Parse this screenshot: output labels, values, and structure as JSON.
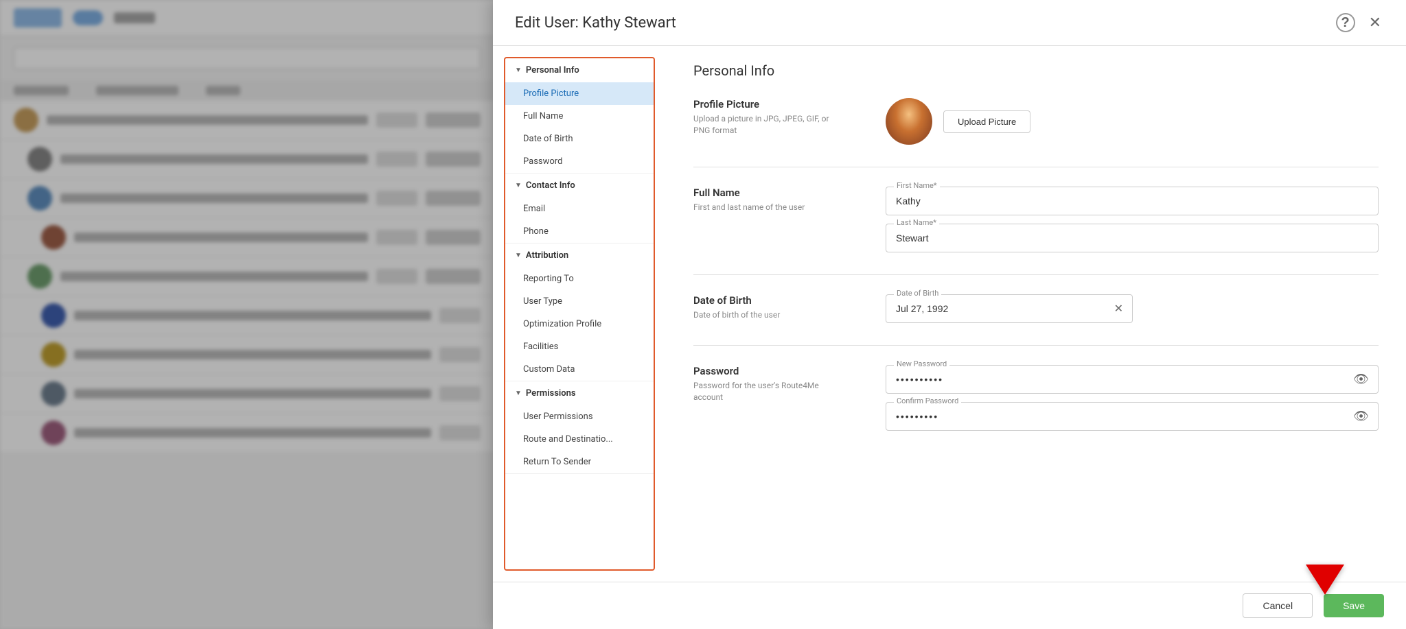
{
  "modal": {
    "title": "Edit User: Kathy Stewart",
    "section_title": "Personal Info"
  },
  "nav": {
    "groups": [
      {
        "label": "Personal Info",
        "expanded": true,
        "items": [
          {
            "label": "Profile Picture",
            "active": true
          },
          {
            "label": "Full Name",
            "active": false
          },
          {
            "label": "Date of Birth",
            "active": false
          },
          {
            "label": "Password",
            "active": false
          }
        ]
      },
      {
        "label": "Contact Info",
        "expanded": true,
        "items": [
          {
            "label": "Email",
            "active": false
          },
          {
            "label": "Phone",
            "active": false
          }
        ]
      },
      {
        "label": "Attribution",
        "expanded": true,
        "items": [
          {
            "label": "Reporting To",
            "active": false
          },
          {
            "label": "User Type",
            "active": false
          },
          {
            "label": "Optimization Profile",
            "active": false
          },
          {
            "label": "Facilities",
            "active": false
          },
          {
            "label": "Custom Data",
            "active": false
          }
        ]
      },
      {
        "label": "Permissions",
        "expanded": true,
        "items": [
          {
            "label": "User Permissions",
            "active": false
          },
          {
            "label": "Route and Destinatio...",
            "active": false
          },
          {
            "label": "Return To Sender",
            "active": false
          }
        ]
      }
    ]
  },
  "fields": {
    "profile_picture": {
      "title": "Profile Picture",
      "desc": "Upload a picture in JPG, JPEG, GIF, or PNG format",
      "upload_label": "Upload Picture"
    },
    "full_name": {
      "title": "Full Name",
      "desc": "First and last name of the user",
      "first_name_label": "First Name*",
      "first_name_value": "Kathy",
      "last_name_label": "Last Name*",
      "last_name_value": "Stewart"
    },
    "dob": {
      "title": "Date of Birth",
      "desc": "Date of birth of the user",
      "label": "Date of Birth",
      "value": "Jul 27, 1992"
    },
    "password": {
      "title": "Password",
      "desc": "Password for the user's Route4Me account",
      "new_password_label": "New Password",
      "new_password_value": "••••••••••",
      "confirm_password_label": "Confirm Password",
      "confirm_password_value": "•••••••••"
    }
  },
  "footer": {
    "cancel_label": "Cancel",
    "save_label": "Save"
  }
}
